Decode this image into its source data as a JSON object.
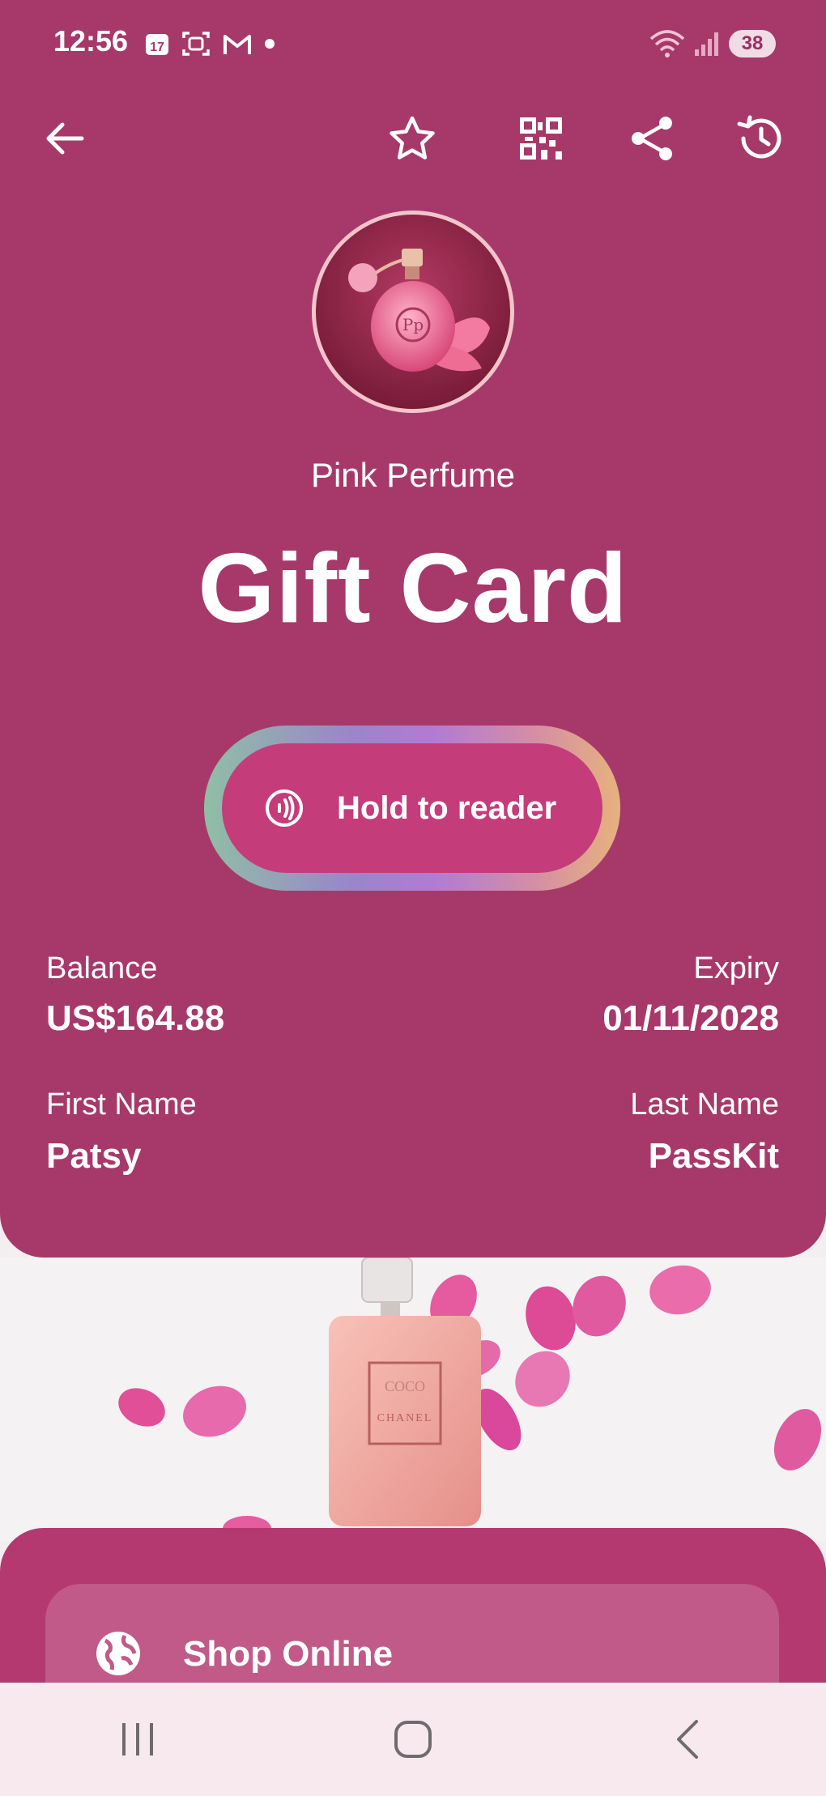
{
  "status_bar": {
    "time": "12:56",
    "calendar_day": "17",
    "battery": "38"
  },
  "topbar": {
    "back_icon": "arrow-left-icon",
    "favorite_icon": "star-icon",
    "qr_icon": "qr-code-icon",
    "share_icon": "share-icon",
    "history_icon": "history-icon"
  },
  "card": {
    "brand": "Pink Perfume",
    "title": "Gift Card",
    "nfc_label": "Hold to reader",
    "fields": {
      "balance_label": "Balance",
      "balance_value": "US$164.88",
      "expiry_label": "Expiry",
      "expiry_value": "01/11/2028",
      "first_name_label": "First Name",
      "first_name_value": "Patsy",
      "last_name_label": "Last Name",
      "last_name_value": "PassKit"
    },
    "colors": {
      "card_bg": "#a7396a",
      "button_bg": "#c43d7a",
      "panel_bg": "#b53971"
    }
  },
  "promo_image": {
    "label_line1": "COCO",
    "label_line2": "CHANEL"
  },
  "links": [
    {
      "label": "Shop Online",
      "icon": "globe-icon"
    }
  ],
  "navigation": {
    "recents_icon": "recents-icon",
    "home_icon": "home-icon",
    "back_icon": "back-chevron-icon"
  }
}
